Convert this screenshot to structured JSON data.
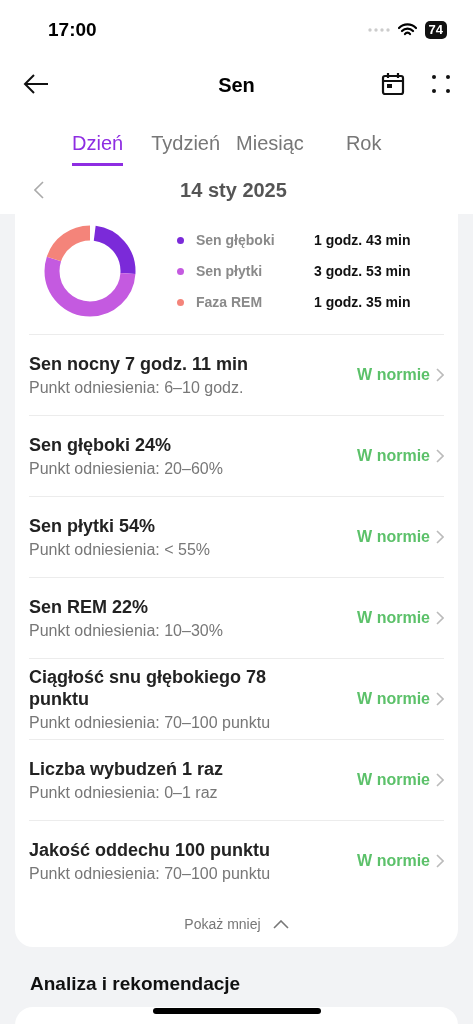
{
  "status_bar": {
    "time": "17:00",
    "battery": "74"
  },
  "header": {
    "title": "Sen"
  },
  "tabs": [
    {
      "label": "Dzień",
      "selected": true
    },
    {
      "label": "Tydzień",
      "selected": false
    },
    {
      "label": "Miesiąc",
      "selected": false
    },
    {
      "label": "Rok",
      "selected": false
    }
  ],
  "date": "14 sty 2025",
  "legend": [
    {
      "label": "Sen głęboki",
      "value": "1 godz. 43 min",
      "color": "#7b2ad9"
    },
    {
      "label": "Sen płytki",
      "value": "3 godz. 53 min",
      "color": "#c45ae0"
    },
    {
      "label": "Faza REM",
      "value": "1 godz. 35 min",
      "color": "#f4847a"
    }
  ],
  "metrics": [
    {
      "title": "Sen nocny 7 godz. 11 min",
      "reference": "Punkt odniesienia: 6–10 godz.",
      "status": "W normie"
    },
    {
      "title": "Sen głęboki 24%",
      "reference": "Punkt odniesienia: 20–60%",
      "status": "W normie"
    },
    {
      "title": "Sen płytki 54%",
      "reference": "Punkt odniesienia: < 55%",
      "status": "W normie"
    },
    {
      "title": "Sen REM 22%",
      "reference": "Punkt odniesienia: 10–30%",
      "status": "W normie"
    },
    {
      "title": "Ciągłość snu głębokiego 78 punktu",
      "reference": "Punkt odniesienia: 70–100 punktu",
      "status": "W normie"
    },
    {
      "title": "Liczba wybudzeń 1 raz",
      "reference": "Punkt odniesienia: 0–1 raz",
      "status": "W normie"
    },
    {
      "title": "Jakość oddechu 100 punktu",
      "reference": "Punkt odniesienia: 70–100 punktu",
      "status": "W normie"
    }
  ],
  "show_less": "Pokaż mniej",
  "section_title": "Analiza i rekomendacje"
}
